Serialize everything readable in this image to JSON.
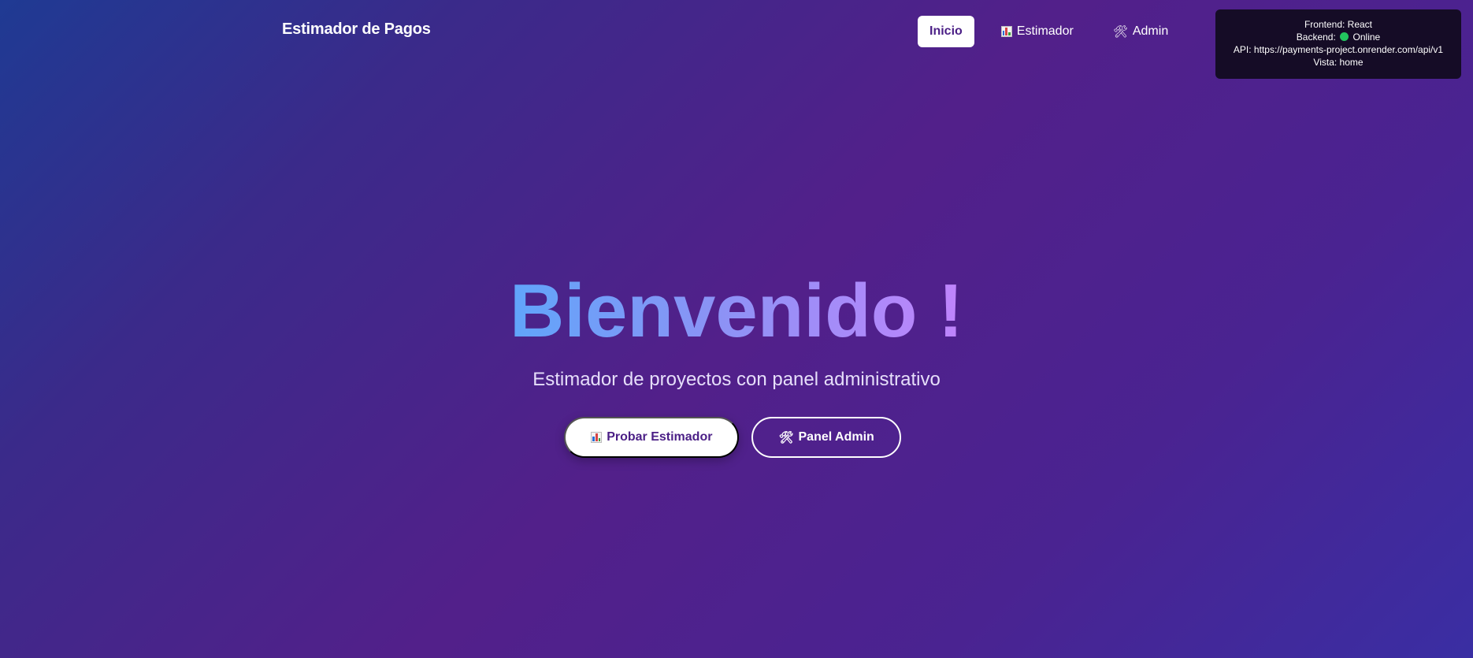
{
  "navbar": {
    "brand": "Estimador de Pagos",
    "links": [
      {
        "label": "Inicio",
        "icon": "",
        "active": true
      },
      {
        "label": "Estimador",
        "icon": "bar-chart-icon",
        "active": false
      },
      {
        "label": "Admin",
        "icon": "hammer-wrench-icon",
        "active": false
      }
    ]
  },
  "debug": {
    "frontend": "Frontend: React",
    "backend_prefix": "Backend:",
    "backend_status": "Online",
    "api": "API: https://payments-project.onrender.com/api/v1",
    "view": "Vista: home"
  },
  "hero": {
    "title": "Bienvenido !",
    "subtitle": "Estimador de proyectos con panel administrativo",
    "primary_button": "Probar Estimador",
    "secondary_button": "Panel Admin"
  },
  "colors": {
    "accent": "#4b1f86",
    "status_online": "#22c55e",
    "title_gradient_start": "#60a5fa",
    "title_gradient_end": "#c084fc"
  }
}
